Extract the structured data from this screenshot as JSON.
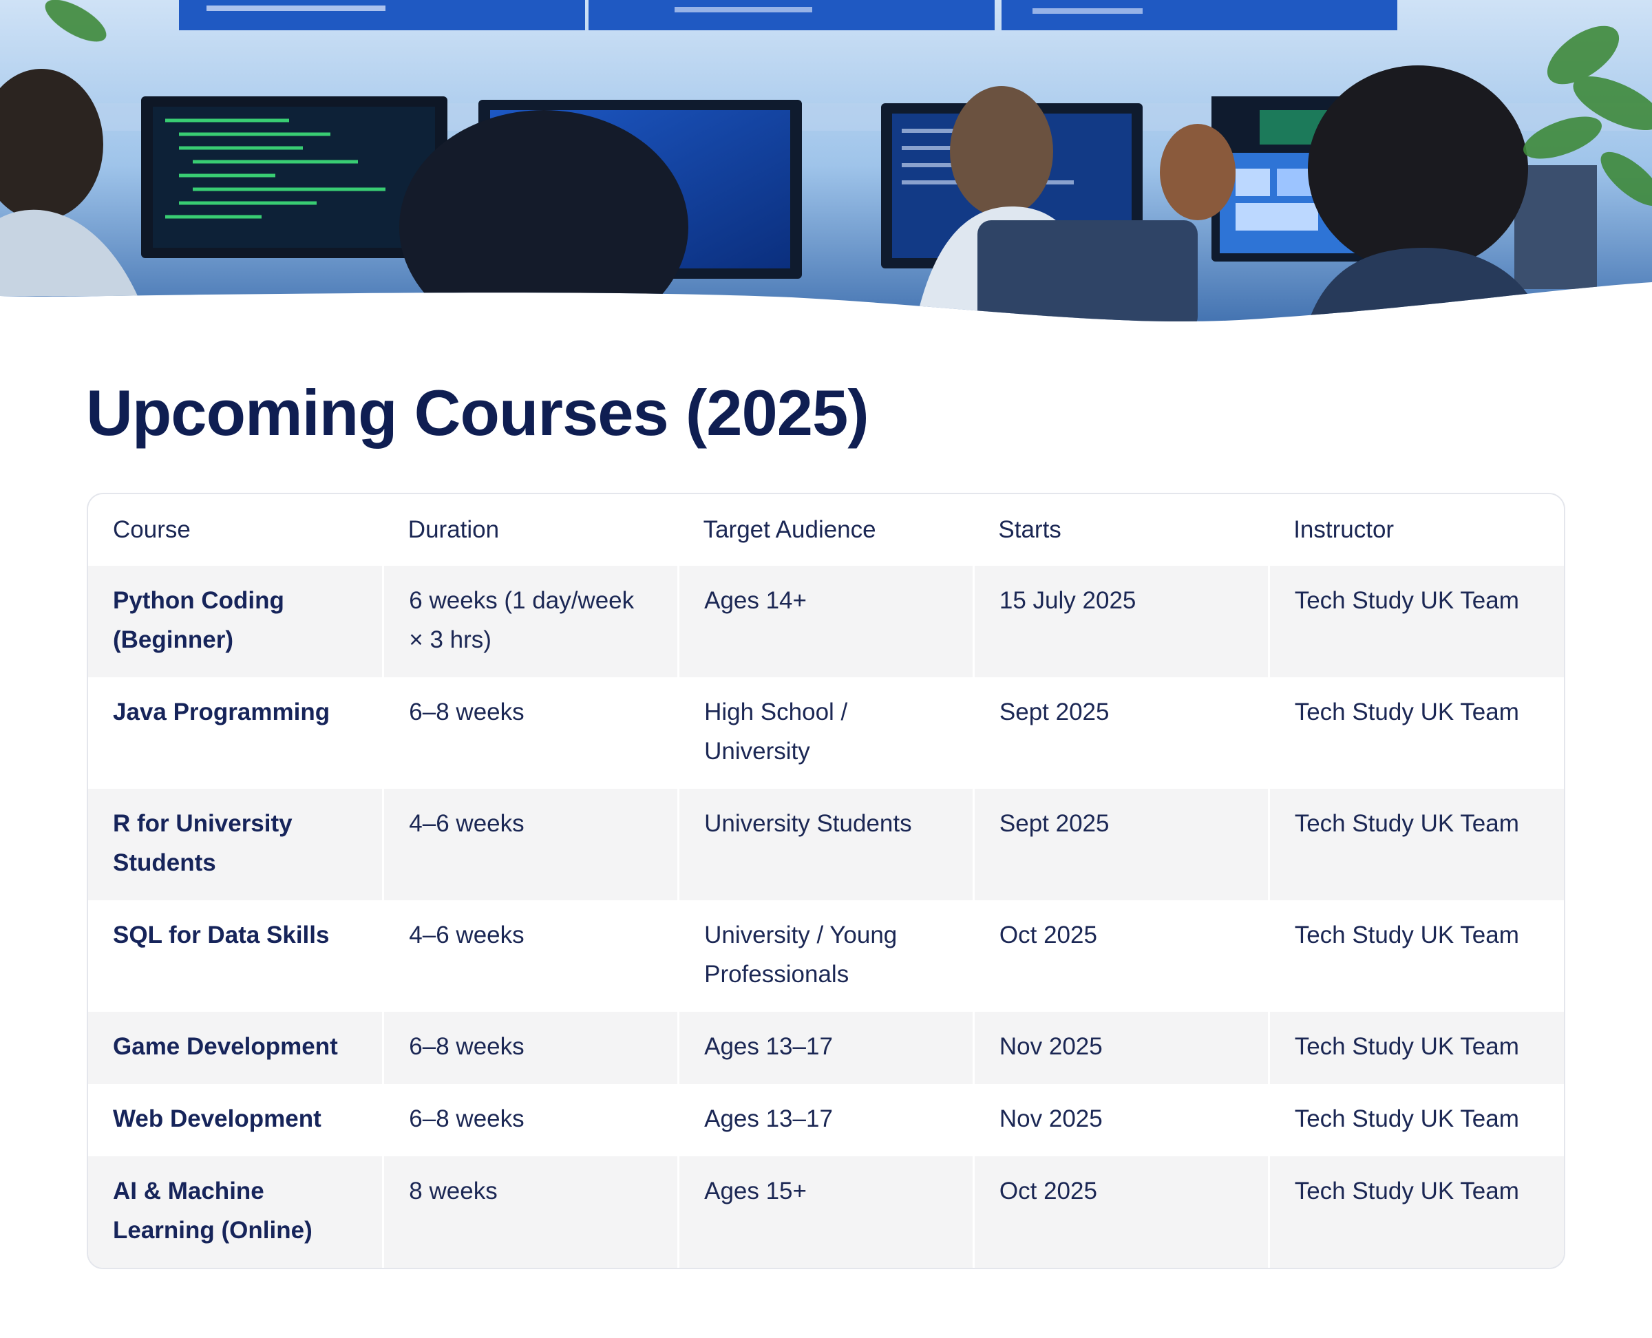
{
  "hero": {
    "image": "classroom-of-students-coding-at-computers"
  },
  "page": {
    "title": "Upcoming Courses (2025)"
  },
  "table": {
    "headers": [
      "Course",
      "Duration",
      "Target Audience",
      "Starts",
      "Instructor"
    ],
    "rows": [
      {
        "course": "Python Coding (Beginner)",
        "duration": "6 weeks (1 day/week × 3 hrs)",
        "audience": "Ages 14+",
        "starts": "15 July 2025",
        "instructor": "Tech Study UK Team"
      },
      {
        "course": "Java Programming",
        "duration": "6–8 weeks",
        "audience": "High School / University",
        "starts": "Sept 2025",
        "instructor": "Tech Study UK Team"
      },
      {
        "course": "R for University Students",
        "duration": "4–6 weeks",
        "audience": "University Students",
        "starts": "Sept 2025",
        "instructor": "Tech Study UK Team"
      },
      {
        "course": "SQL for Data Skills",
        "duration": "4–6 weeks",
        "audience": "University / Young Professionals",
        "starts": "Oct 2025",
        "instructor": "Tech Study UK Team"
      },
      {
        "course": "Game Development",
        "duration": "6–8 weeks",
        "audience": "Ages 13–17",
        "starts": "Nov 2025",
        "instructor": "Tech Study UK Team"
      },
      {
        "course": "Web Development",
        "duration": "6–8 weeks",
        "audience": "Ages 13–17",
        "starts": "Nov 2025",
        "instructor": "Tech Study UK Team"
      },
      {
        "course": "AI & Machine Learning (Online)",
        "duration": "8 weeks",
        "audience": "Ages 15+",
        "starts": "Oct 2025",
        "instructor": "Tech Study UK Team"
      }
    ]
  },
  "colors": {
    "title": "#0f1e52",
    "text": "#1b2754",
    "row_shade": "#f4f4f5",
    "border": "#e4e6ec"
  }
}
